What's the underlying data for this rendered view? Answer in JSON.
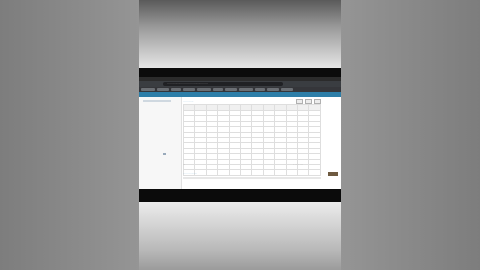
{
  "browser": {
    "url_text": "···········································"
  },
  "page": {
    "title": "···········",
    "section2_title": "···············"
  },
  "table": {
    "headers": [
      "",
      "",
      "",
      "",
      "",
      "",
      "",
      "",
      "",
      "",
      "",
      ""
    ],
    "rows": [
      [
        "",
        "",
        "",
        "",
        "",
        "",
        "",
        "",
        "",
        "",
        "",
        ""
      ],
      [
        "",
        "",
        "",
        "",
        "",
        "",
        "",
        "",
        "",
        "",
        "",
        ""
      ],
      [
        "",
        "",
        "",
        "",
        "",
        "",
        "",
        "",
        "",
        "",
        "",
        ""
      ],
      [
        "",
        "",
        "",
        "",
        "",
        "",
        "",
        "",
        "",
        "",
        "",
        ""
      ],
      [
        "",
        "",
        "",
        "",
        "",
        "",
        "",
        "",
        "",
        "",
        "",
        ""
      ],
      [
        "",
        "",
        "",
        "",
        "",
        "",
        "",
        "",
        "",
        "",
        "",
        ""
      ],
      [
        "",
        "",
        "",
        "",
        "",
        "",
        "",
        "",
        "",
        "",
        "",
        ""
      ],
      [
        "",
        "",
        "",
        "",
        "",
        "",
        "",
        "",
        "",
        "",
        "",
        ""
      ],
      [
        "",
        "",
        "",
        "",
        "",
        "",
        "",
        "",
        "",
        "",
        "",
        ""
      ],
      [
        "",
        "",
        "",
        "",
        "",
        "",
        "",
        "",
        "",
        "",
        "",
        ""
      ],
      [
        "",
        "",
        "",
        "",
        "",
        "",
        "",
        "",
        "",
        "",
        "",
        ""
      ],
      [
        "",
        "",
        "",
        "",
        "",
        "",
        "",
        "",
        "",
        "",
        "",
        ""
      ]
    ]
  },
  "pager": {
    "left": "···",
    "pages": "· · · · · · · ·"
  },
  "colors": {
    "app_header": "#2d7ea8",
    "link_blue": "#4a90c0"
  }
}
